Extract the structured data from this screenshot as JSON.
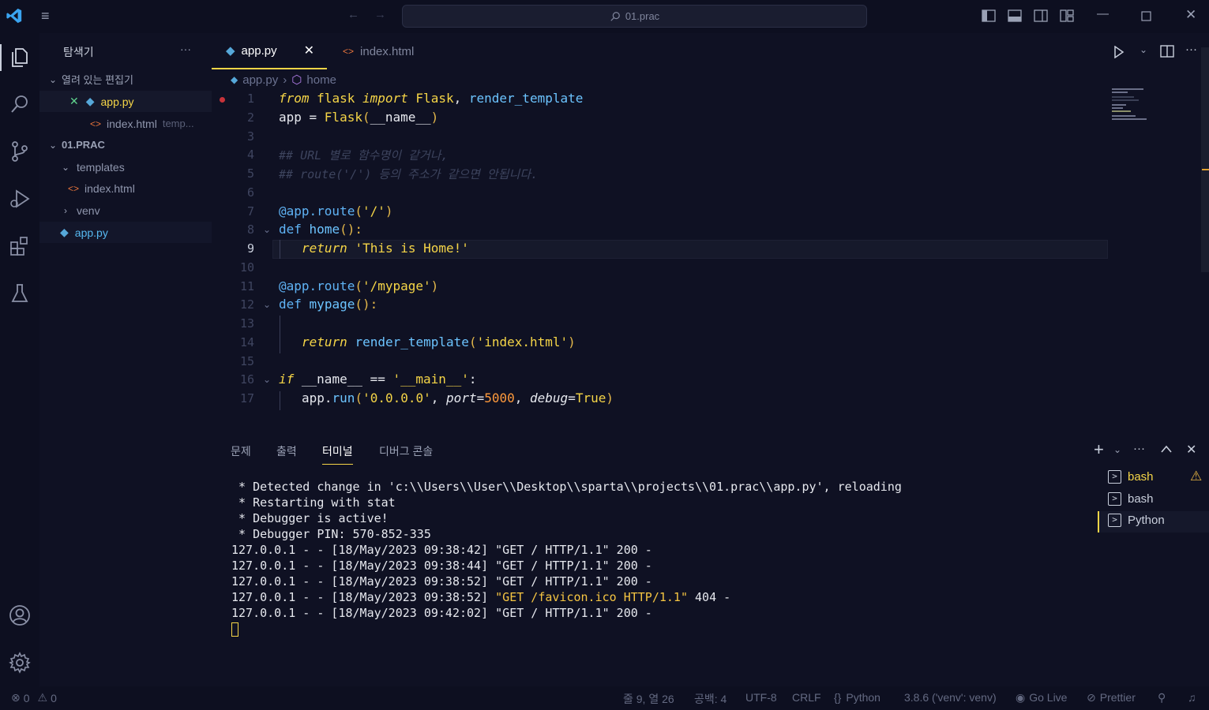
{
  "titlebar": {
    "search_text": "01.prac"
  },
  "activity": [
    "explorer-icon",
    "search-icon",
    "source-control-icon",
    "run-debug-icon",
    "extensions-icon",
    "testing-icon",
    "account-icon",
    "settings-icon"
  ],
  "sidebar": {
    "title": "탐색기",
    "more": "···",
    "open_editors_label": "열려 있는 편집기",
    "open_editors": [
      {
        "name": "app.py",
        "close": "✕"
      },
      {
        "name": "index.html",
        "detail": "temp..."
      }
    ],
    "folder_label": "01.PRAC",
    "tree": [
      {
        "name": "templates",
        "chev": "v"
      },
      {
        "name": "index.html"
      },
      {
        "name": "venv",
        "chev": ">"
      },
      {
        "name": "app.py"
      }
    ]
  },
  "tabs": [
    {
      "label": "app.py",
      "close": "✕"
    },
    {
      "label": "index.html"
    }
  ],
  "breadcrumb": {
    "file": "app.py",
    "sep": "›",
    "symbol": "home"
  },
  "line_numbers": [
    "1",
    "2",
    "3",
    "4",
    "5",
    "6",
    "7",
    "8",
    "9",
    "10",
    "11",
    "12",
    "13",
    "14",
    "15",
    "16",
    "17"
  ],
  "code": {
    "l1": {
      "from": "from",
      "mod": "flask",
      "imp": "import",
      "c1": "Flask",
      "comma": ",",
      "c2": "render_template"
    },
    "l2": {
      "a": "app = ",
      "f": "Flask",
      "p1": "(",
      "n": "__name__",
      "p2": ")"
    },
    "l4": "## URL 별로 함수명이 같거나,",
    "l5": "## route('/') 등의 주소가 같으면 안됩니다.",
    "l7": {
      "dec": "@app.route",
      "p1": "(",
      "s": "'/'",
      "p2": ")"
    },
    "l8": {
      "def": "def",
      "name": "home",
      "paren": "():"
    },
    "l9": {
      "ret": "return",
      "s": "'This is Home!'"
    },
    "l11": {
      "dec": "@app.route",
      "p1": "(",
      "s": "'/mypage'",
      "p2": ")"
    },
    "l12": {
      "def": "def",
      "name": "mypage",
      "paren": "():"
    },
    "l14": {
      "ret": "return",
      "fn": "render_template",
      "p1": "(",
      "s": "'index.html'",
      "p2": ")"
    },
    "l16": {
      "if": "if",
      "n": "__name__",
      "eq": " == ",
      "s": "'__main__'",
      "colon": ":"
    },
    "l17": {
      "a": "app.",
      "fn": "run",
      "p1": "(",
      "s": "'0.0.0.0'",
      "c1": ", ",
      "port": "port",
      "eq1": "=",
      "num": "5000",
      "c2": ", ",
      "debug": "debug",
      "eq2": "=",
      "t": "True",
      "p2": ")"
    }
  },
  "panel": {
    "tabs": [
      "문제",
      "출력",
      "터미널",
      "디버그 콘솔"
    ],
    "active_tab": "터미널",
    "terminal_lines": [
      " * Detected change in 'c:\\\\Users\\\\User\\\\Desktop\\\\sparta\\\\projects\\\\01.prac\\\\app.py', reloading",
      " * Restarting with stat",
      " * Debugger is active!",
      " * Debugger PIN: 570-852-335",
      "127.0.0.1 - - [18/May/2023 09:38:42] \"GET / HTTP/1.1\" 200 -",
      "127.0.0.1 - - [18/May/2023 09:38:44] \"GET / HTTP/1.1\" 200 -",
      "127.0.0.1 - - [18/May/2023 09:38:52] \"GET / HTTP/1.1\" 200 -"
    ],
    "line_404": {
      "pre": "127.0.0.1 - - [18/May/2023 09:38:52] ",
      "req": "\"GET /favicon.ico HTTP/1.1\"",
      "post": " 404 -"
    },
    "line_last": "127.0.0.1 - - [18/May/2023 09:42:02] \"GET / HTTP/1.1\" 200 -",
    "terminals": [
      "bash",
      "bash",
      "Python"
    ],
    "warning_icon": "⚠"
  },
  "status": {
    "errors": "0",
    "warnings": "0",
    "position": "줄 9, 열 26",
    "spaces": "공백: 4",
    "encoding": "UTF-8",
    "eol": "CRLF",
    "language": "Python",
    "interpreter": "3.8.6 ('venv': venv)",
    "golive": "Go Live",
    "prettier": "Prettier"
  },
  "colors": {
    "accent": "#f5d547",
    "background": "#0f1123",
    "bars": "#0d0f20"
  }
}
